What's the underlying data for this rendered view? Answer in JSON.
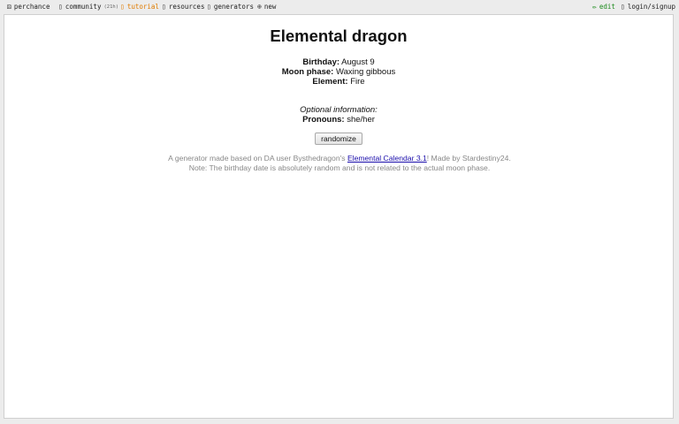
{
  "nav": {
    "logo_label": "perchance",
    "community_label": "community",
    "community_count": "(21h)",
    "tutorial_label": "tutorial",
    "resources_label": "resources",
    "generators_label": "generators",
    "new_label": "new",
    "edit_label": "edit",
    "login_label": "login/signup"
  },
  "icons": {
    "logo": "dice-icon",
    "community": "chat-icon",
    "tutorial": "book-icon",
    "resources": "folder-icon",
    "generators": "list-icon",
    "new": "plus-circle-icon",
    "edit": "pencil-icon",
    "login": "user-icon"
  },
  "colors": {
    "tutorial": "#e07b00",
    "edit": "#1a8a1a",
    "link": "#1a0dab"
  },
  "main": {
    "title": "Elemental dragon",
    "birthday_label": "Birthday:",
    "birthday_value": "August 9",
    "moon_label": "Moon phase:",
    "moon_value": "Waxing gibbous",
    "element_label": "Element:",
    "element_value": "Fire",
    "optional_heading": "Optional information:",
    "pronouns_label": "Pronouns:",
    "pronouns_value": "she/her",
    "randomize_label": "randomize",
    "desc_before": "A generator made based on DA user Bysthedragon's ",
    "desc_link": "Elemental Calendar 3.1",
    "desc_after": "! Made by Stardestiny24. Note: The birthday date is absolutely random and is not related to the actual moon phase."
  }
}
